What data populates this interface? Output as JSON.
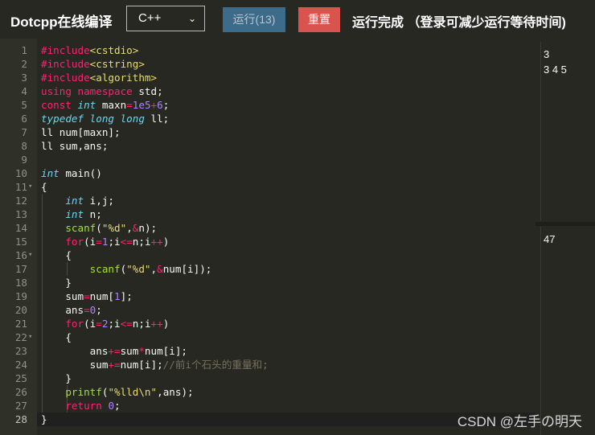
{
  "header": {
    "brand": "Dotcpp在线编译",
    "language": "C++",
    "run_label": "运行(13)",
    "reset_label": "重置",
    "status": "运行完成 （登录可减少运行等待时间)"
  },
  "editor": {
    "lines": [
      "1",
      "2",
      "3",
      "4",
      "5",
      "6",
      "7",
      "8",
      "9",
      "10",
      "11",
      "12",
      "13",
      "14",
      "15",
      "16",
      "17",
      "18",
      "19",
      "20",
      "21",
      "22",
      "23",
      "24",
      "25",
      "26",
      "27",
      "28"
    ]
  },
  "output": {
    "input_lines": [
      "3",
      "3 4 5"
    ],
    "result": "47"
  },
  "watermark": "CSDN @左手の明天",
  "colors": {
    "background": "#272822",
    "run_button": "#3d6b8a",
    "reset_button": "#d9534f",
    "keyword": "#f92672",
    "type": "#66d9ef",
    "string": "#e6db74",
    "number": "#ae81ff",
    "comment": "#75715e"
  },
  "icons": {
    "select": "chevron-down-icon",
    "fold": "fold-triangle-icon"
  }
}
